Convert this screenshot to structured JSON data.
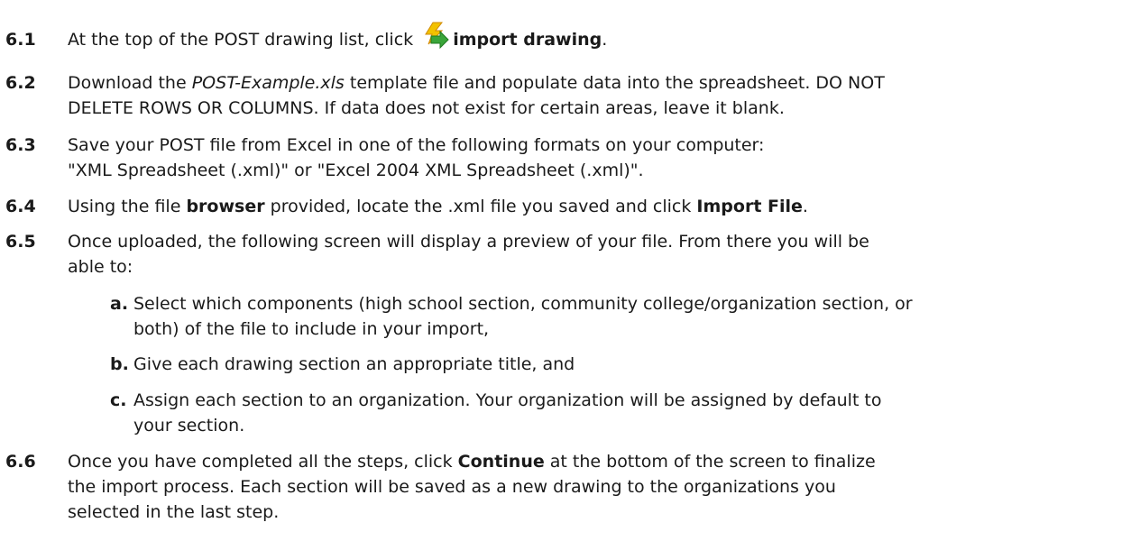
{
  "steps": [
    {
      "num": "6.1",
      "lines": [
        [
          "At the top of the POST drawing list, click ",
          "import drawing",
          "."
        ]
      ]
    },
    {
      "num": "6.2",
      "lines": [
        [
          "Download the ",
          "POST-Example.xls",
          " template file and populate data into the spreadsheet. DO NOT"
        ],
        "DELETE ROWS OR COLUMNS. If data does not exist for certain areas, leave it blank."
      ]
    },
    {
      "num": "6.3",
      "lines": [
        "Save your POST file from Excel in one of the following formats on your computer:",
        "\"XML Spreadsheet (.xml)\" or \"Excel 2004 XML Spreadsheet (.xml)\"."
      ]
    },
    {
      "num": "6.4",
      "lines": [
        [
          "Using the file ",
          "browser",
          " provided, locate the .xml file you saved and click ",
          "Import File",
          "."
        ]
      ]
    },
    {
      "num": "6.5",
      "lines": [
        "Once uploaded, the following screen will display a preview of your file. From there you will be",
        "able to:"
      ],
      "subs": [
        {
          "letter": "a.",
          "lines": [
            "Select which components (high school section, community college/organization section, or",
            "both) of the file to include in your import,"
          ]
        },
        {
          "letter": "b.",
          "lines": [
            "Give each drawing section an appropriate title, and"
          ]
        },
        {
          "letter": "c.",
          "lines": [
            "Assign each section to an organization. Your organization will be assigned by default to",
            "your section."
          ]
        }
      ]
    },
    {
      "num": "6.6",
      "lines": [
        [
          "Once you have completed all the steps, click ",
          "Continue",
          " at the bottom of the screen to finalize"
        ],
        "the import process. Each section will be saved as a new drawing to the organizations you",
        "selected in the last step."
      ]
    }
  ],
  "icons": {
    "import": "import-drawing-icon"
  },
  "colors": {
    "text": "#1a1a1a",
    "icon_yellow": "#f2c200",
    "icon_green": "#3aa53a"
  }
}
